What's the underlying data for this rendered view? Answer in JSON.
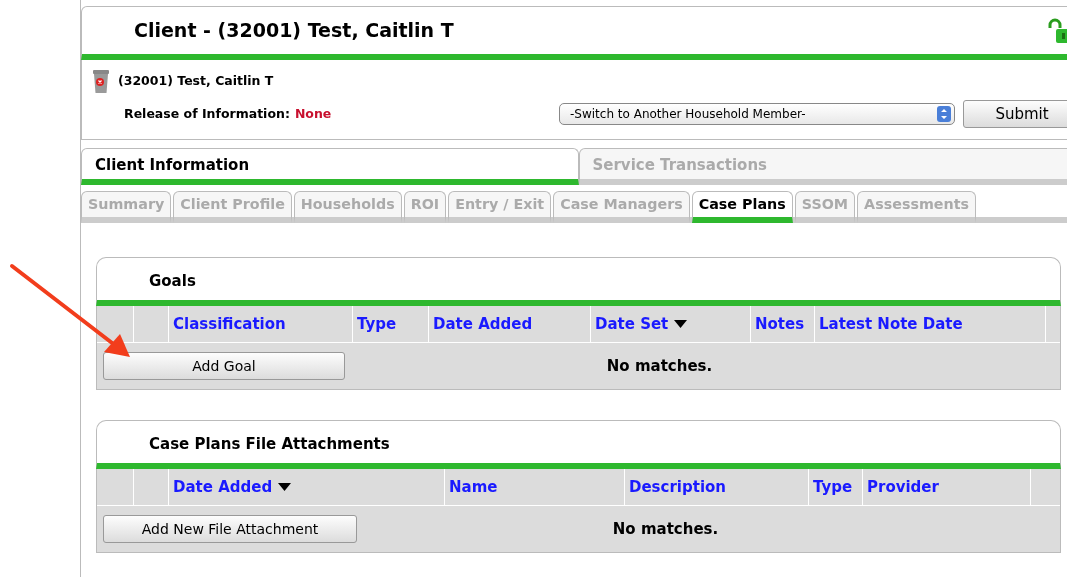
{
  "header": {
    "title": "Client - (32001) Test, Caitlin T",
    "locked": false
  },
  "client": {
    "name": "(32001) Test, Caitlin T",
    "roi_label": "Release of Information:",
    "roi_value": "None"
  },
  "household_select": {
    "value": "-Switch to Another Household Member-"
  },
  "submit_button": "Submit",
  "main_tabs": [
    {
      "label": "Client Information",
      "selected": true
    },
    {
      "label": "Service Transactions",
      "selected": false
    }
  ],
  "sub_tabs": [
    {
      "label": "Summary",
      "selected": false
    },
    {
      "label": "Client Profile",
      "selected": false
    },
    {
      "label": "Households",
      "selected": false
    },
    {
      "label": "ROI",
      "selected": false
    },
    {
      "label": "Entry / Exit",
      "selected": false
    },
    {
      "label": "Case Managers",
      "selected": false
    },
    {
      "label": "Case Plans",
      "selected": true
    },
    {
      "label": "SSOM",
      "selected": false
    },
    {
      "label": "Assessments",
      "selected": false
    }
  ],
  "panels": [
    {
      "title": "Goals",
      "columns": [
        {
          "label": "Classification",
          "sorted": false
        },
        {
          "label": "Type",
          "sorted": false
        },
        {
          "label": "Date Added",
          "sorted": false
        },
        {
          "label": "Date Set",
          "sorted": true
        },
        {
          "label": "Notes",
          "sorted": false
        },
        {
          "label": "Latest Note Date",
          "sorted": false
        }
      ],
      "add_button": "Add Goal",
      "empty_text": "No matches."
    },
    {
      "title": "Case Plans File Attachments",
      "columns": [
        {
          "label": "Date Added",
          "sorted": true
        },
        {
          "label": "Name",
          "sorted": false
        },
        {
          "label": "Description",
          "sorted": false
        },
        {
          "label": "Type",
          "sorted": false
        },
        {
          "label": "Provider",
          "sorted": false
        }
      ],
      "add_button": "Add New File Attachment",
      "empty_text": "No matches."
    }
  ]
}
